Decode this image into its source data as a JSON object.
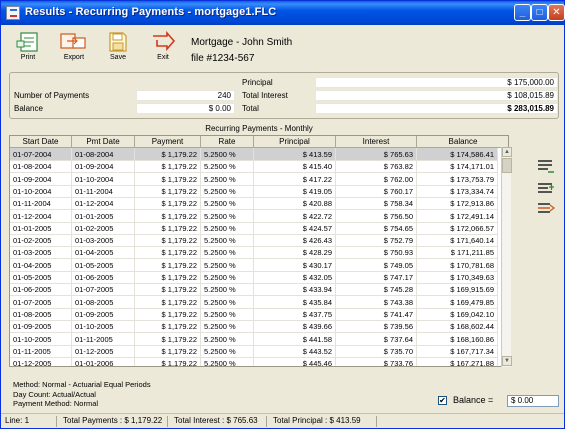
{
  "window": {
    "title": "Results - Recurring Payments - mortgage1.FLC"
  },
  "toolbar": {
    "print": "Print",
    "export": "Export",
    "save": "Save",
    "exit": "Exit"
  },
  "header": {
    "name": "Mortgage - John Smith",
    "file": "file #1234-567"
  },
  "summary": {
    "num_payments_label": "Number of Payments",
    "num_payments": "240",
    "balance_label": "Balance",
    "balance": "$ 0.00",
    "principal_label": "Principal",
    "principal": "$ 175,000.00",
    "total_interest_label": "Total Interest",
    "total_interest": "$ 108,015.89",
    "total_label": "Total",
    "total": "$ 283,015.89"
  },
  "grid": {
    "title": "Recurring Payments - Monthly",
    "columns": [
      "Start Date",
      "Pmt Date",
      "Payment",
      "Rate",
      "Principal",
      "Interest",
      "Balance"
    ],
    "rows": [
      [
        "01-07-2004",
        "01-08-2004",
        "$ 1,179.22",
        "5.2500 %",
        "$ 413.59",
        "$ 765.63",
        "$ 174,586.41"
      ],
      [
        "01-08-2004",
        "01-09-2004",
        "$ 1,179.22",
        "5.2500 %",
        "$ 415.40",
        "$ 763.82",
        "$ 174,171.01"
      ],
      [
        "01-09-2004",
        "01-10-2004",
        "$ 1,179.22",
        "5.2500 %",
        "$ 417.22",
        "$ 762.00",
        "$ 173,753.79"
      ],
      [
        "01-10-2004",
        "01-11-2004",
        "$ 1,179.22",
        "5.2500 %",
        "$ 419.05",
        "$ 760.17",
        "$ 173,334.74"
      ],
      [
        "01-11-2004",
        "01-12-2004",
        "$ 1,179.22",
        "5.2500 %",
        "$ 420.88",
        "$ 758.34",
        "$ 172,913.86"
      ],
      [
        "01-12-2004",
        "01-01-2005",
        "$ 1,179.22",
        "5.2500 %",
        "$ 422.72",
        "$ 756.50",
        "$ 172,491.14"
      ],
      [
        "01-01-2005",
        "01-02-2005",
        "$ 1,179.22",
        "5.2500 %",
        "$ 424.57",
        "$ 754.65",
        "$ 172,066.57"
      ],
      [
        "01-02-2005",
        "01-03-2005",
        "$ 1,179.22",
        "5.2500 %",
        "$ 426.43",
        "$ 752.79",
        "$ 171,640.14"
      ],
      [
        "01-03-2005",
        "01-04-2005",
        "$ 1,179.22",
        "5.2500 %",
        "$ 428.29",
        "$ 750.93",
        "$ 171,211.85"
      ],
      [
        "01-04-2005",
        "01-05-2005",
        "$ 1,179.22",
        "5.2500 %",
        "$ 430.17",
        "$ 749.05",
        "$ 170,781.68"
      ],
      [
        "01-05-2005",
        "01-06-2005",
        "$ 1,179.22",
        "5.2500 %",
        "$ 432.05",
        "$ 747.17",
        "$ 170,349.63"
      ],
      [
        "01-06-2005",
        "01-07-2005",
        "$ 1,179.22",
        "5.2500 %",
        "$ 433.94",
        "$ 745.28",
        "$ 169,915.69"
      ],
      [
        "01-07-2005",
        "01-08-2005",
        "$ 1,179.22",
        "5.2500 %",
        "$ 435.84",
        "$ 743.38",
        "$ 169,479.85"
      ],
      [
        "01-08-2005",
        "01-09-2005",
        "$ 1,179.22",
        "5.2500 %",
        "$ 437.75",
        "$ 741.47",
        "$ 169,042.10"
      ],
      [
        "01-09-2005",
        "01-10-2005",
        "$ 1,179.22",
        "5.2500 %",
        "$ 439.66",
        "$ 739.56",
        "$ 168,602.44"
      ],
      [
        "01-10-2005",
        "01-11-2005",
        "$ 1,179.22",
        "5.2500 %",
        "$ 441.58",
        "$ 737.64",
        "$ 168,160.86"
      ],
      [
        "01-11-2005",
        "01-12-2005",
        "$ 1,179.22",
        "5.2500 %",
        "$ 443.52",
        "$ 735.70",
        "$ 167,717.34"
      ],
      [
        "01-12-2005",
        "01-01-2006",
        "$ 1,179.22",
        "5.2500 %",
        "$ 445.46",
        "$ 733.76",
        "$ 167,271.88"
      ]
    ]
  },
  "footer": {
    "method": "Method: Normal - Actuarial Equal Periods",
    "day_count": "Day Count: Actual/Actual",
    "payment_method": "Payment Method: Normal",
    "balance_label": "Balance =",
    "balance_value": "$ 0.00",
    "balance_checked": "✔"
  },
  "status": {
    "line": "Line: 1",
    "total_payments": "Total Payments : $ 1,179.22",
    "total_interest": "Total Interest : $ 765.63",
    "total_principal": "Total Principal : $ 413.59"
  },
  "icons": {
    "app": "app-icon",
    "print": "print-icon",
    "export": "export-icon",
    "save": "save-icon",
    "exit": "exit-arrow-icon"
  },
  "colors": {
    "title_bar": "#0055e5",
    "selected_row": "#d0d0d0",
    "accent_green": "#2e8b3c",
    "accent_orange": "#d05a1a"
  }
}
